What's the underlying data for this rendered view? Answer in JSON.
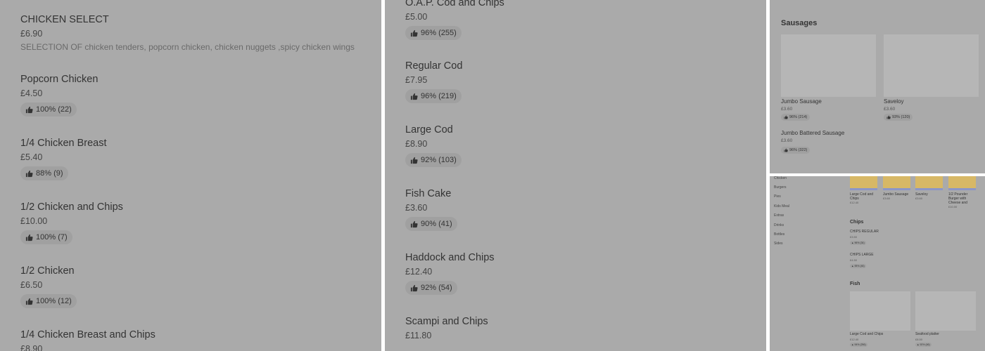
{
  "left_panel": {
    "items": [
      {
        "name": "CHICKEN SELECT",
        "price": "£6.90",
        "description": "SELECTION OF chicken tenders, popcorn chicken, chicken nuggets ,spicy chicken wings"
      },
      {
        "name": "Popcorn Chicken",
        "price": "£4.50",
        "rating": "100% (22)"
      },
      {
        "name": "1/4 Chicken Breast",
        "price": "£5.40",
        "rating": "88% (9)"
      },
      {
        "name": "1/2 Chicken and Chips",
        "price": "£10.00",
        "rating": "100% (7)"
      },
      {
        "name": "1/2 Chicken",
        "price": "£6.50",
        "rating": "100% (12)"
      },
      {
        "name": "1/4 Chicken Breast and Chips",
        "price": "£8.90"
      }
    ]
  },
  "mid_panel": {
    "items": [
      {
        "name": "O.A.P. Cod and Chips",
        "price": "£5.00",
        "rating": "96% (255)"
      },
      {
        "name": "Regular Cod",
        "price": "£7.95",
        "rating": "96% (219)"
      },
      {
        "name": "Large Cod",
        "price": "£8.90",
        "rating": "92% (103)"
      },
      {
        "name": "Fish Cake",
        "price": "£3.60",
        "rating": "90% (41)"
      },
      {
        "name": "Haddock and Chips",
        "price": "£12.40",
        "rating": "92% (54)"
      },
      {
        "name": "Scampi and Chips",
        "price": "£11.80"
      }
    ]
  },
  "top_right_panel": {
    "section_title": "Sausages",
    "cards": [
      {
        "name": "Jumbo Sausage",
        "price": "£3.60",
        "rating": "96% (214)"
      },
      {
        "name": "Saveloy",
        "price": "£3.60",
        "rating": "93% (120)"
      }
    ],
    "extra_item": {
      "name": "Jumbo Battered Sausage",
      "price": "£3.60",
      "rating": "96% (322)"
    }
  },
  "bottom_right_panel": {
    "nav": [
      "Chicken",
      "Burgers",
      "Pies",
      "Kids Meal",
      "Extras",
      "Drinks",
      "Bottles",
      "Sides"
    ],
    "featured": [
      {
        "name": "Large Cod and Chips",
        "price": "£12.40"
      },
      {
        "name": "Jumbo Sausage",
        "price": "£3.60"
      },
      {
        "name": "Saveloy",
        "price": "£3.60"
      },
      {
        "name": "1/2 Pounder Burger with Cheese and",
        "price": "£10.00"
      }
    ],
    "chips_section": {
      "title": "Chips",
      "items": [
        {
          "name": "CHIPS REGULAR",
          "price": "£3.50",
          "rating": "96% (34)"
        },
        {
          "name": "CHIPS LARGE",
          "price": "£4.50",
          "rating": "95% (46)"
        }
      ]
    },
    "fish_section": {
      "title": "Fish",
      "cards": [
        {
          "name": "Large Cod and Chips",
          "price": "£12.40",
          "rating": "94% (256)"
        },
        {
          "name": "Seafood platter",
          "price": "£8.50",
          "rating": "92% (46)"
        }
      ]
    }
  }
}
